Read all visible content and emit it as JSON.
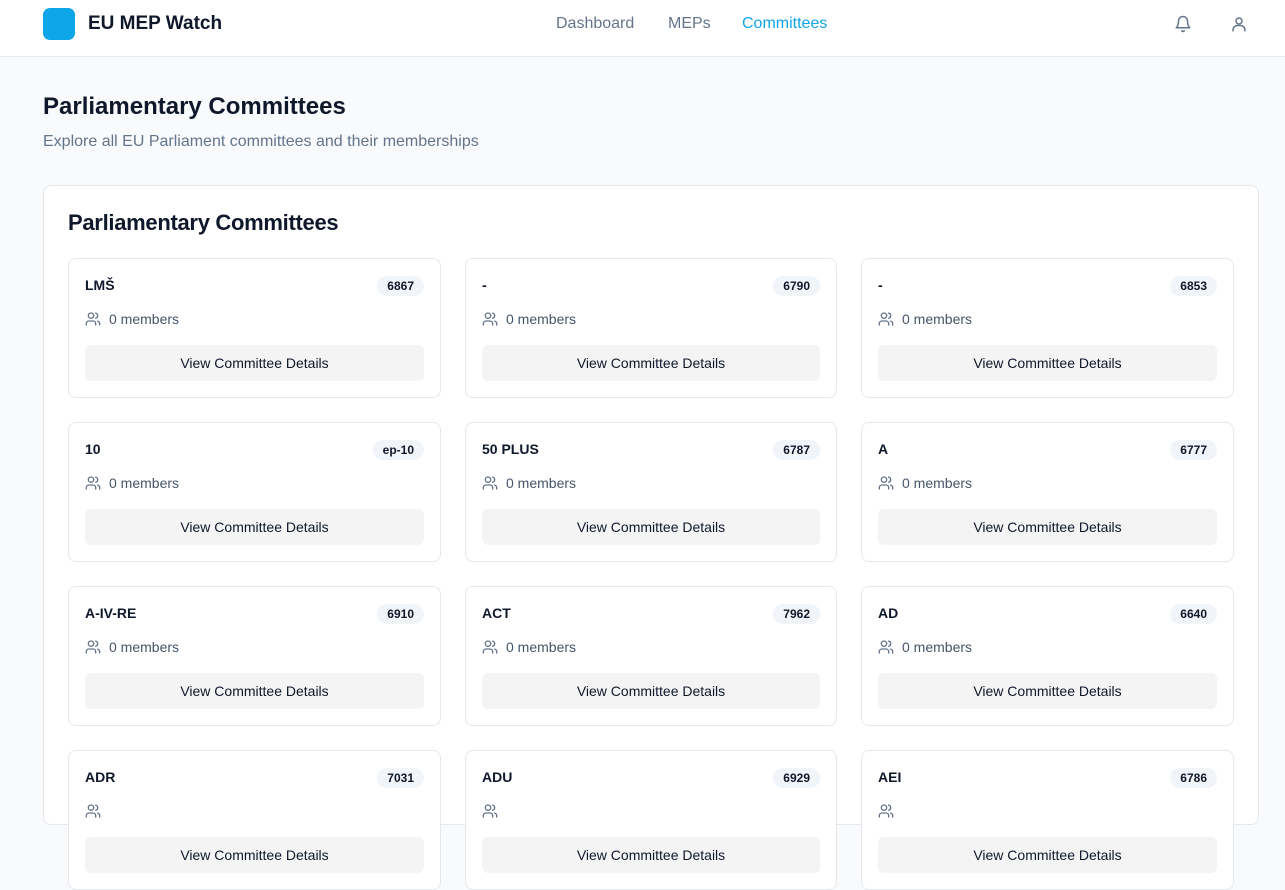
{
  "app": {
    "title": "EU MEP Watch",
    "brand_color": "#0ea5e9"
  },
  "nav": {
    "items": [
      {
        "label": "Dashboard",
        "active": false
      },
      {
        "label": "MEPs",
        "active": false
      },
      {
        "label": "Committees",
        "active": true
      }
    ],
    "icons": [
      "bell-icon",
      "user-icon"
    ]
  },
  "page": {
    "title": "Parliamentary Committees",
    "subtitle": "Explore all EU Parliament committees and their memberships"
  },
  "panel": {
    "title": "Parliamentary Committees",
    "button_label": "View Committee Details",
    "committees": [
      {
        "name": "LMŠ",
        "id": "6867",
        "members": "0 members"
      },
      {
        "name": "-",
        "id": "6790",
        "members": "0 members"
      },
      {
        "name": "-",
        "id": "6853",
        "members": "0 members"
      },
      {
        "name": "10",
        "id": "ep-10",
        "members": "0 members"
      },
      {
        "name": "50 PLUS",
        "id": "6787",
        "members": "0 members"
      },
      {
        "name": "A",
        "id": "6777",
        "members": "0 members"
      },
      {
        "name": "A-IV-RE",
        "id": "6910",
        "members": "0 members"
      },
      {
        "name": "ACT",
        "id": "7962",
        "members": "0 members"
      },
      {
        "name": "AD",
        "id": "6640",
        "members": "0 members"
      },
      {
        "name": "ADR",
        "id": "7031",
        "members": ""
      },
      {
        "name": "ADU",
        "id": "6929",
        "members": ""
      },
      {
        "name": "AEI",
        "id": "6786",
        "members": ""
      }
    ]
  }
}
